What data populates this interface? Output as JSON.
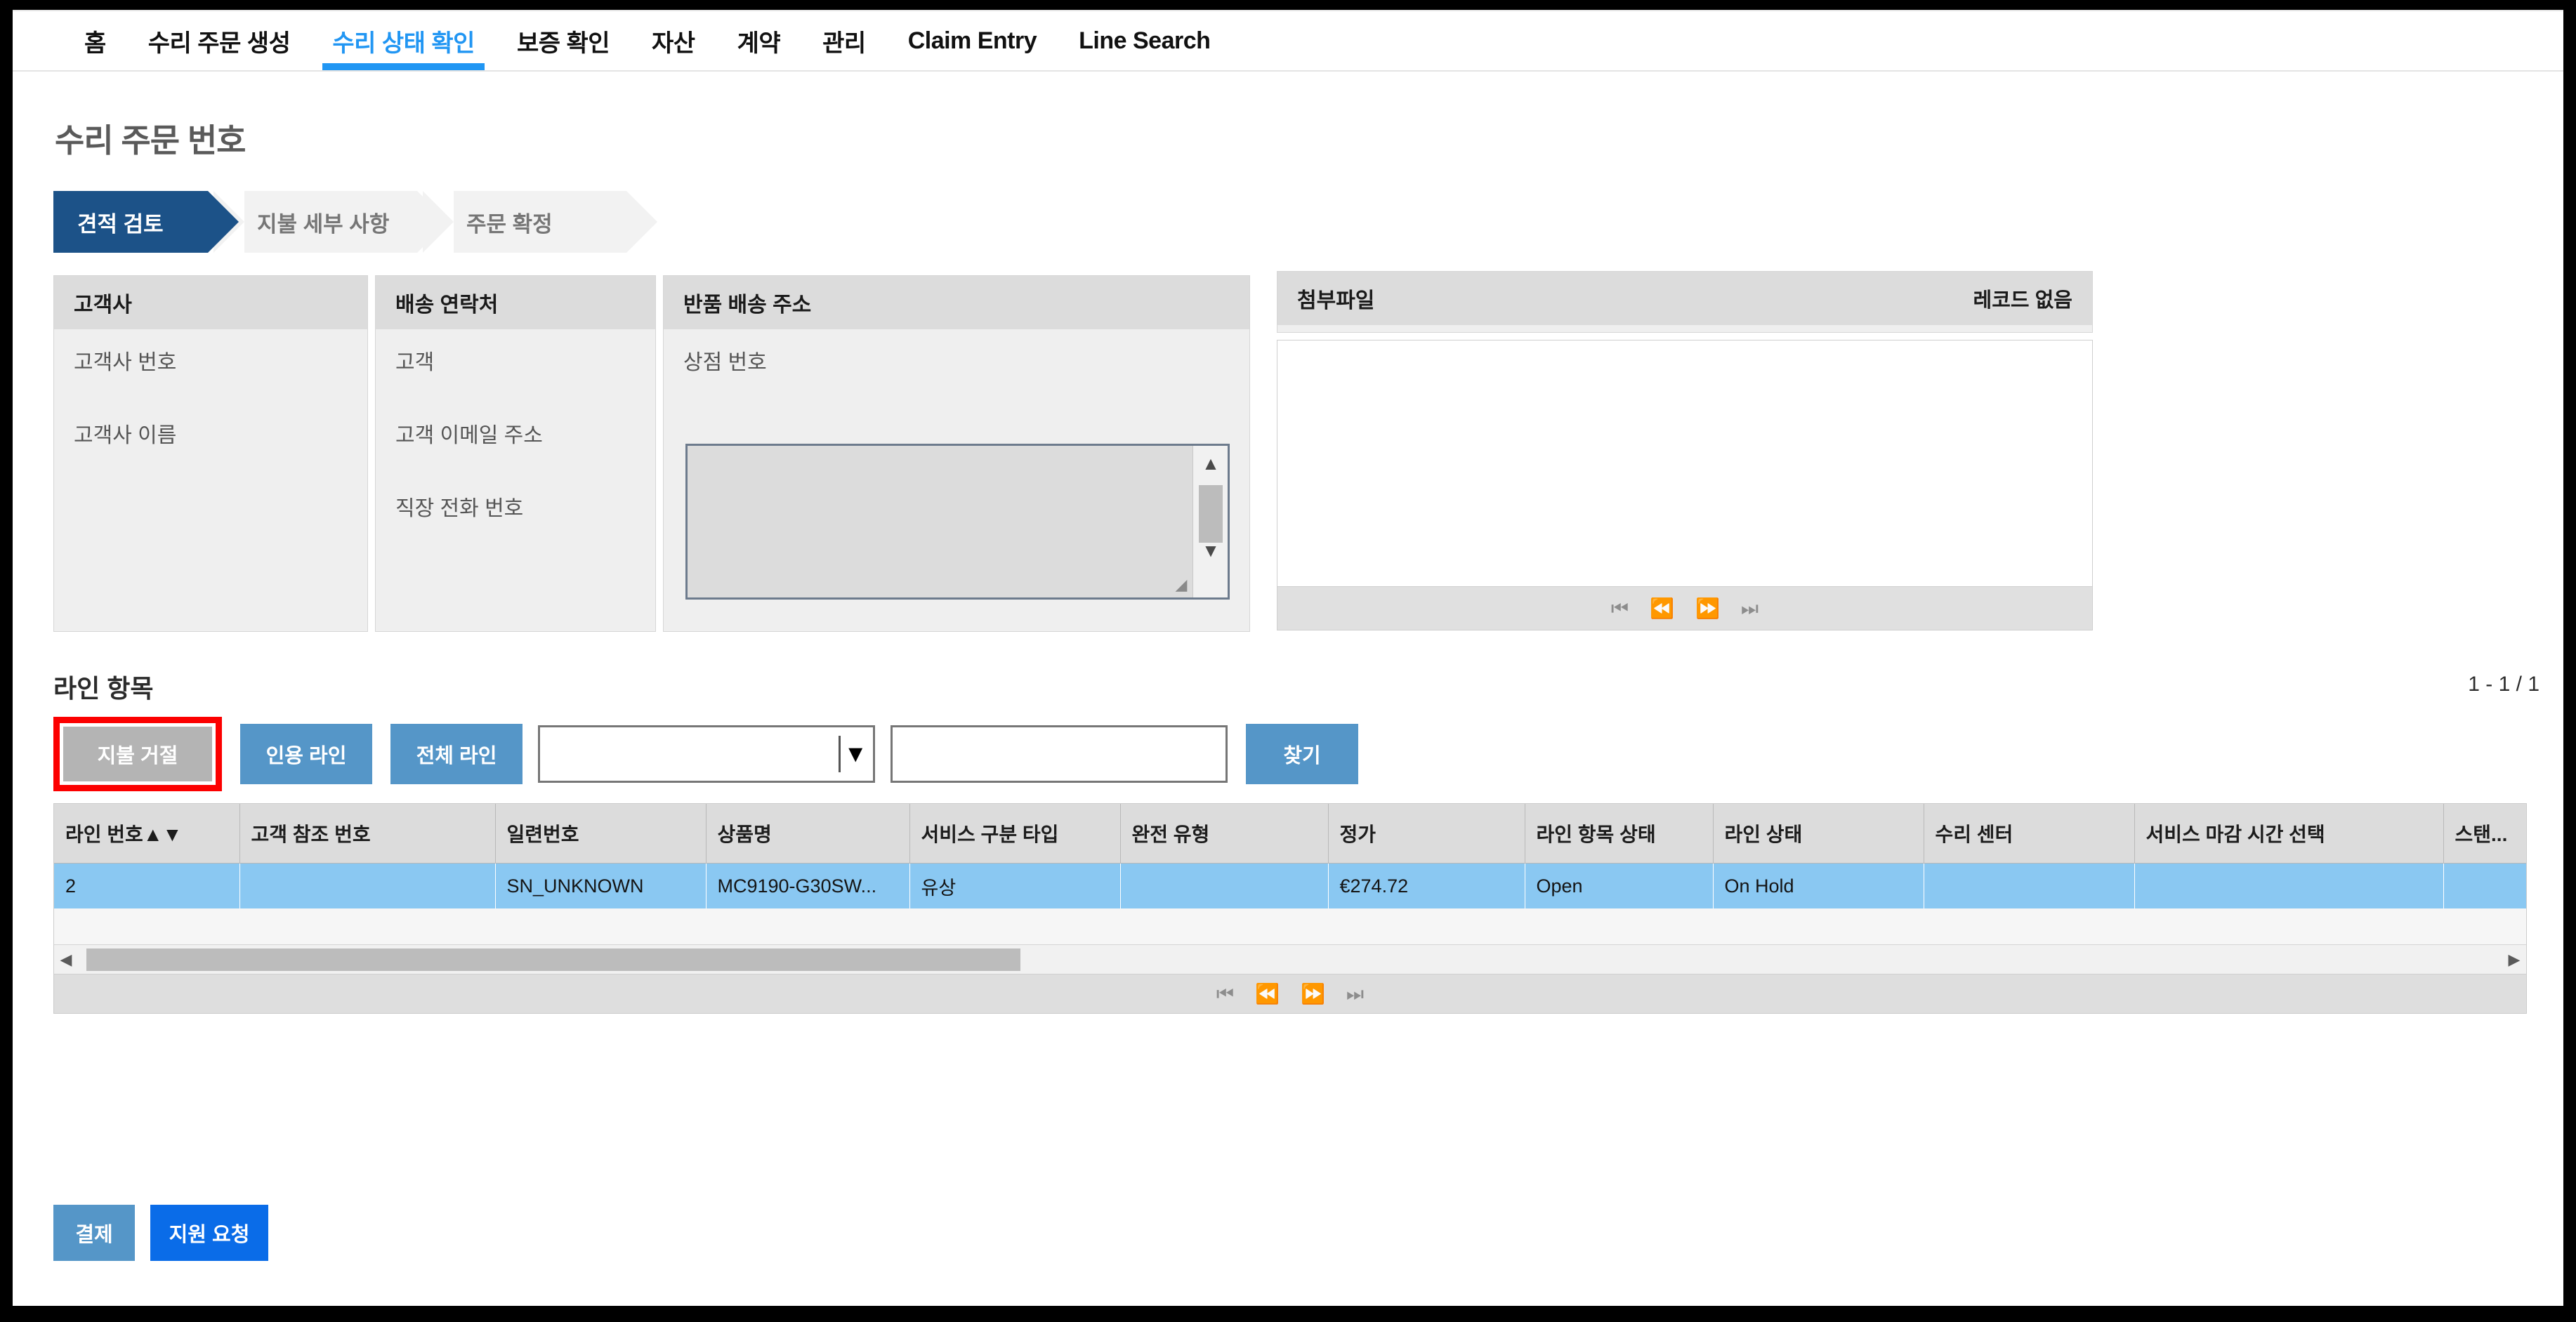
{
  "nav": {
    "items": [
      {
        "label": "홈",
        "active": false
      },
      {
        "label": "수리 주문 생성",
        "active": false
      },
      {
        "label": "수리 상태 확인",
        "active": true
      },
      {
        "label": "보증 확인",
        "active": false
      },
      {
        "label": "자산",
        "active": false
      },
      {
        "label": "계약",
        "active": false
      },
      {
        "label": "관리",
        "active": false
      },
      {
        "label": "Claim Entry",
        "active": false
      },
      {
        "label": "Line Search",
        "active": false
      }
    ]
  },
  "page": {
    "title": "수리 주문 번호"
  },
  "steps": [
    {
      "label": "견적 검토",
      "state": "done"
    },
    {
      "label": "지불 세부 사항",
      "state": "todo"
    },
    {
      "label": "주문 확정",
      "state": "todo"
    }
  ],
  "panels": {
    "customer": {
      "title": "고객사",
      "fields": [
        "고객사 번호",
        "고객사 이름"
      ]
    },
    "shipping": {
      "title": "배송 연락처",
      "fields": [
        "고객",
        "고객 이메일 주소",
        "직장 전화 번호"
      ]
    },
    "return_address": {
      "title": "반품 배송 주소",
      "fields": [
        "상점 번호"
      ],
      "textarea_value": ""
    },
    "attachments": {
      "title": "첨부파일",
      "meta": "레코드 없음",
      "pager": [
        "⏮",
        "⏪",
        "⏩",
        "⏭"
      ]
    }
  },
  "line_items": {
    "section_title": "라인 항목",
    "record_count": "1 - 1 / 1",
    "toolbar": {
      "reject_payment_label": "지불 거절",
      "quote_line_label": "인용 라인",
      "all_lines_label": "전체 라인",
      "find_label": "찾기",
      "filter_select_value": "",
      "filter_select_placeholder": "",
      "search_input_value": "",
      "search_input_placeholder": ""
    },
    "columns": [
      "라인 번호▲▼",
      "고객 참조 번호",
      "일련번호",
      "상품명",
      "서비스 구분 타입",
      "완전 유형",
      "정가",
      "라인 항목 상태",
      "라인 상태",
      "수리 센터",
      "서비스 마감 시간 선택",
      "스탠..."
    ],
    "rows": [
      {
        "라인 번호▲▼": "2",
        "고객 참조 번호": "",
        "일련번호": "SN_UNKNOWN",
        "상품명": "MC9190-G30SW...",
        "서비스 구분 타입": "유상",
        "완전 유형": "",
        "정가": "€274.72",
        "라인 항목 상태": "Open",
        "라인 상태": "On Hold",
        "수리 센터": "",
        "서비스 마감 시간 선택": "",
        "스탠...": ""
      }
    ],
    "pager": [
      "⏮",
      "⏪",
      "⏩",
      "⏭"
    ]
  },
  "footer": {
    "pay_label": "결제",
    "support_label": "지원 요청"
  },
  "colors": {
    "accent_blue": "#2196f3",
    "step_done": "#1c5288",
    "button_blue": "#5596c8",
    "support_blue": "#0a6ce8",
    "row_selected": "#8ac8f2",
    "highlight_red": "#fc0000",
    "disabled_gray": "#b4b4b4"
  }
}
